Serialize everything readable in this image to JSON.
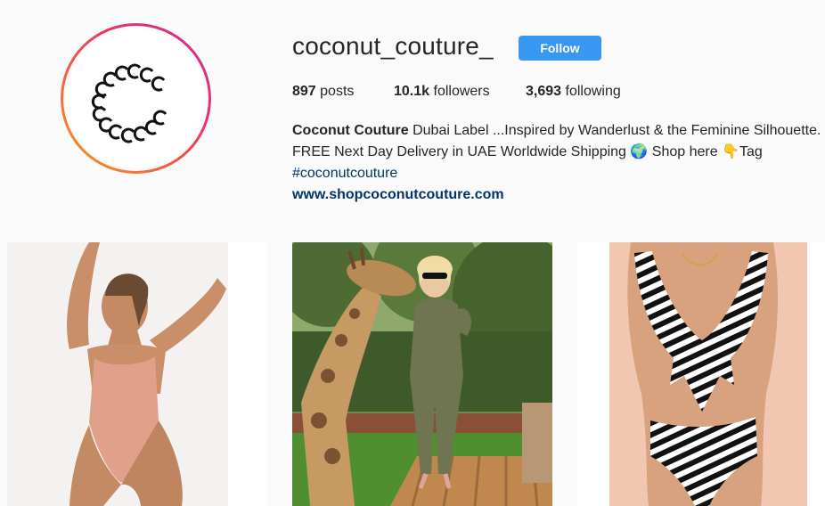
{
  "profile": {
    "username": "coconut_couture_",
    "follow_label": "Follow",
    "stats": {
      "posts_count": "897",
      "posts_label": "posts",
      "followers_count": "10.1k",
      "followers_label": "followers",
      "following_count": "3,693",
      "following_label": "following"
    },
    "bio": {
      "full_name": "Coconut Couture",
      "line1_text": " Dubai Label ...Inspired by Wanderlust & the Feminine Silhouette.",
      "line2_text": "FREE Next Day Delivery in UAE Worldwide Shipping 🌍 Shop here 👇Tag",
      "hashtag": "#coconutcouture",
      "website": "www.shopcoconutcouture.com"
    }
  },
  "posts": [
    {
      "subject": "model in peach one-piece swimsuit"
    },
    {
      "subject": "woman in olive jumpsuit kissing giraffe"
    },
    {
      "subject": "model in black and white striped swimsuit"
    }
  ],
  "colors": {
    "follow_button": "#3897f0",
    "link": "#003569",
    "ring_start": "#f9a01b",
    "ring_end": "#c72fa6"
  }
}
